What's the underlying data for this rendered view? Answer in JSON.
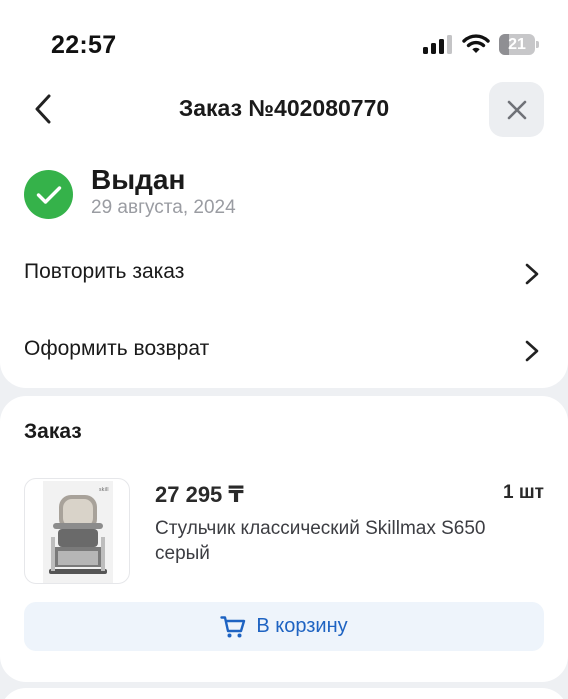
{
  "status_bar": {
    "time": "22:57",
    "battery": "21"
  },
  "header": {
    "title": "Заказ №402080770"
  },
  "order_status": {
    "title": "Выдан",
    "date": "29 августа, 2024"
  },
  "actions": [
    {
      "label": "Повторить заказ"
    },
    {
      "label": "Оформить возврат"
    }
  ],
  "order": {
    "section_title": "Заказ",
    "item": {
      "price": "27 295 ₸",
      "quantity": "1 шт",
      "name": "Стульчик классический Skillmax S650 серый"
    },
    "cart_button_label": "В корзину"
  },
  "colors": {
    "accent": "#1e63c2",
    "success": "#35b24a",
    "background": "#eef0f3"
  },
  "icons": [
    "signal-icon",
    "wifi-icon",
    "battery-icon",
    "back-arrow-icon",
    "close-icon",
    "check-icon",
    "chevron-right-icon",
    "cart-icon"
  ]
}
